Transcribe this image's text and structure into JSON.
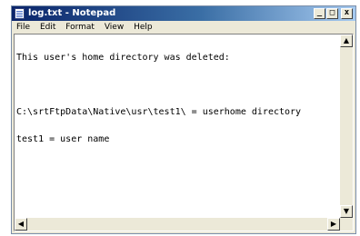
{
  "window": {
    "title": "log.txt - Notepad",
    "controls": {
      "minimize": "_",
      "maximize": "□",
      "close": "x"
    }
  },
  "menubar": {
    "items": [
      "File",
      "Edit",
      "Format",
      "View",
      "Help"
    ]
  },
  "document": {
    "lines": [
      "This user's home directory was deleted:",
      "",
      "C:\\srtFtpData\\Native\\usr\\test1\\ = userhome directory",
      "test1 = user name"
    ]
  },
  "scrollbar_icons": {
    "up": "arrow-up-icon",
    "down": "arrow-down-icon",
    "left": "arrow-left-icon",
    "right": "arrow-right-icon"
  }
}
